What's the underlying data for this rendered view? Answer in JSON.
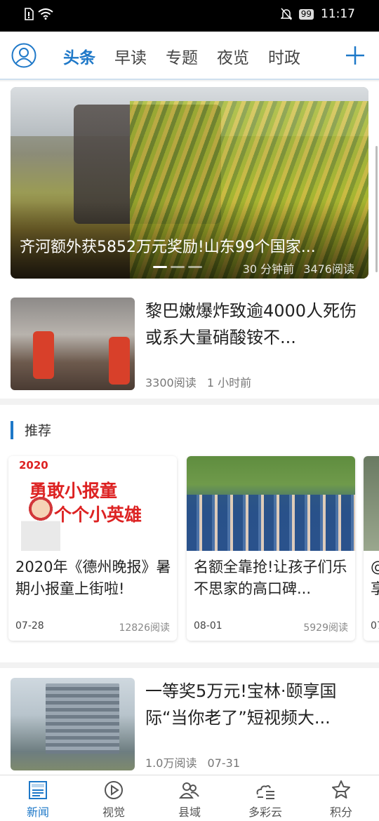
{
  "status_bar": {
    "time": "11:17",
    "battery": "99"
  },
  "top_nav": {
    "tabs": [
      {
        "label": "头条",
        "active": true
      },
      {
        "label": "早读",
        "active": false
      },
      {
        "label": "专题",
        "active": false
      },
      {
        "label": "夜览",
        "active": false
      },
      {
        "label": "时政",
        "active": false
      }
    ]
  },
  "hero": {
    "title": "齐河额外获5852万元奖励!山东99个国家...",
    "time": "30 分钟前",
    "reads": "3476阅读"
  },
  "articles": [
    {
      "title": "黎巴嫩爆炸致逾4000人死伤 或系大量硝酸铵不...",
      "reads": "3300阅读",
      "time": "1 小时前"
    },
    {
      "title": "一等奖5万元!宝林·颐享国际“当你老了”短视频大...",
      "reads": "1.0万阅读",
      "time": "07-31"
    }
  ],
  "recommend": {
    "header": "推荐",
    "cards": [
      {
        "title": "2020年《德州晚报》暑期小报童上街啦!",
        "date": "07-28",
        "reads": "12826阅读",
        "poster": {
          "year": "2020",
          "line1": "勇敢小报童",
          "line2": "个个小英雄"
        }
      },
      {
        "title": "名额全靠抢!让孩子们乐不思家的高口碑...",
        "date": "08-01",
        "reads": "5929阅读"
      }
    ],
    "partial": {
      "title": "@ 享",
      "date": "07"
    }
  },
  "bottom_nav": [
    {
      "label": "新闻",
      "icon": "newspaper-icon",
      "active": true
    },
    {
      "label": "视觉",
      "icon": "play-circle-icon",
      "active": false
    },
    {
      "label": "县域",
      "icon": "people-icon",
      "active": false
    },
    {
      "label": "多彩云",
      "icon": "cloud-list-icon",
      "active": false
    },
    {
      "label": "积分",
      "icon": "star-badge-icon",
      "active": false
    }
  ],
  "colors": {
    "accent": "#1e78c8",
    "background": "#f2f2f2"
  }
}
